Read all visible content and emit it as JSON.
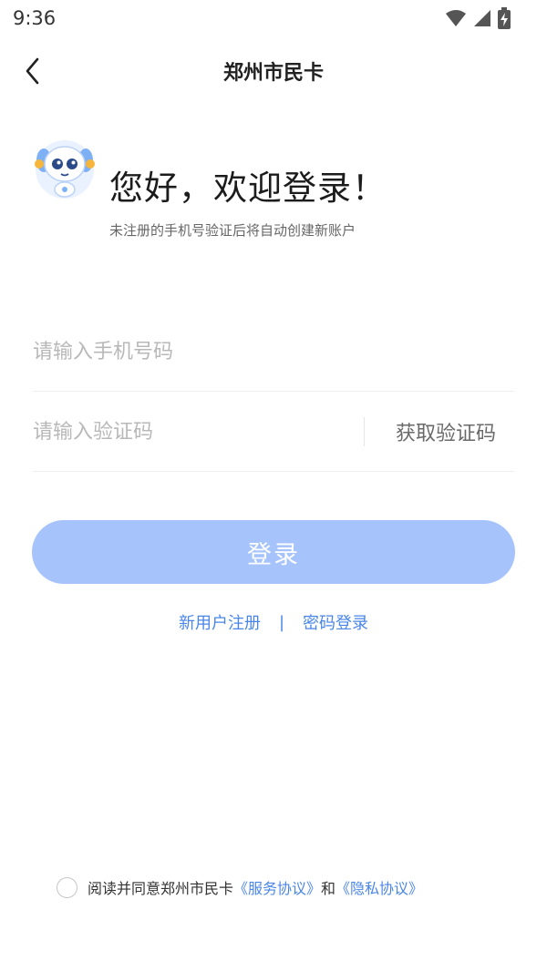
{
  "status_bar": {
    "time": "9:36",
    "icons": [
      "wifi-icon",
      "cellular-signal-icon",
      "battery-charging-icon"
    ]
  },
  "nav": {
    "title": "郑州市民卡",
    "back_icon": "chevron-left-icon"
  },
  "welcome": {
    "title": "您好，欢迎登录！",
    "subtitle": "未注册的手机号验证后将自动创建新账户"
  },
  "form": {
    "phone_placeholder": "请输入手机号码",
    "code_placeholder": "请输入验证码",
    "get_code_label": "获取验证码",
    "login_label": "登录"
  },
  "links": {
    "register": "新用户注册",
    "separator": "|",
    "password_login": "密码登录"
  },
  "agreement": {
    "prefix": "阅读并同意郑州市民卡",
    "service": "《服务协议》",
    "and": "和",
    "privacy": "《隐私协议》",
    "checked": false
  },
  "colors": {
    "accent": "#4a86e8",
    "login_button_disabled": "#a6c3fb",
    "placeholder": "#b8b8b8"
  }
}
